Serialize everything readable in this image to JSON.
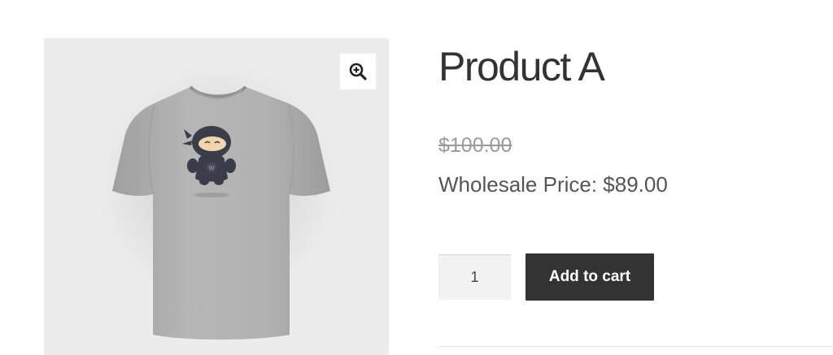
{
  "product": {
    "title": "Product A",
    "regular_price": "$100.00",
    "wholesale_price_text": "Wholesale Price: $89.00"
  },
  "gallery": {
    "zoom_icon": "zoom-in-icon",
    "image_subject": "grey t-shirt with ninja mascot"
  },
  "cart": {
    "quantity": "1",
    "add_to_cart_label": "Add to cart"
  },
  "colors": {
    "button_bg": "#333333",
    "gallery_bg": "#ececec",
    "strike_price": "#9b9b9b"
  }
}
